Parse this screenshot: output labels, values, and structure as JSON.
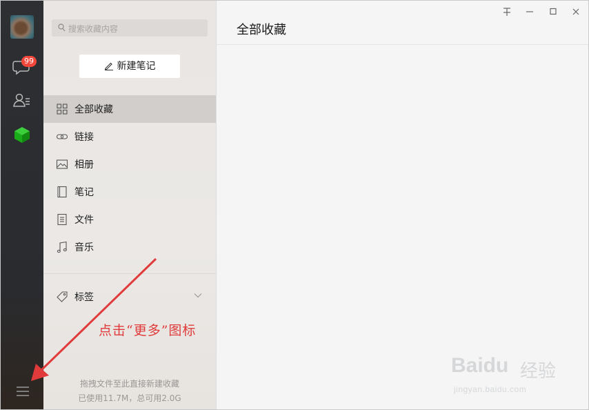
{
  "rail": {
    "chat_badge": "99"
  },
  "search": {
    "placeholder": "搜索收藏内容"
  },
  "new_note_label": "新建笔记",
  "nav": [
    {
      "label": "全部收藏",
      "icon": "grid-icon"
    },
    {
      "label": "链接",
      "icon": "link-icon"
    },
    {
      "label": "相册",
      "icon": "image-icon"
    },
    {
      "label": "笔记",
      "icon": "notebook-icon"
    },
    {
      "label": "文件",
      "icon": "file-icon"
    },
    {
      "label": "音乐",
      "icon": "music-icon"
    }
  ],
  "tags_label": "标签",
  "footer": {
    "drag_hint": "拖拽文件至此直接新建收藏",
    "storage": "已使用11.7M，总可用2.0G"
  },
  "main": {
    "title": "全部收藏"
  },
  "annotation": "点击“更多”图标",
  "watermark": {
    "brand": "Baidu",
    "brand2": "经验",
    "url": "jingyan.baidu.com"
  },
  "colors": {
    "rail": "#2d2f33",
    "panel": "#e9e6e3",
    "active_item": "#d1cecb",
    "badge": "#f2473a",
    "accent_green": "#1aad19",
    "annotation_red": "#e03a3a"
  }
}
